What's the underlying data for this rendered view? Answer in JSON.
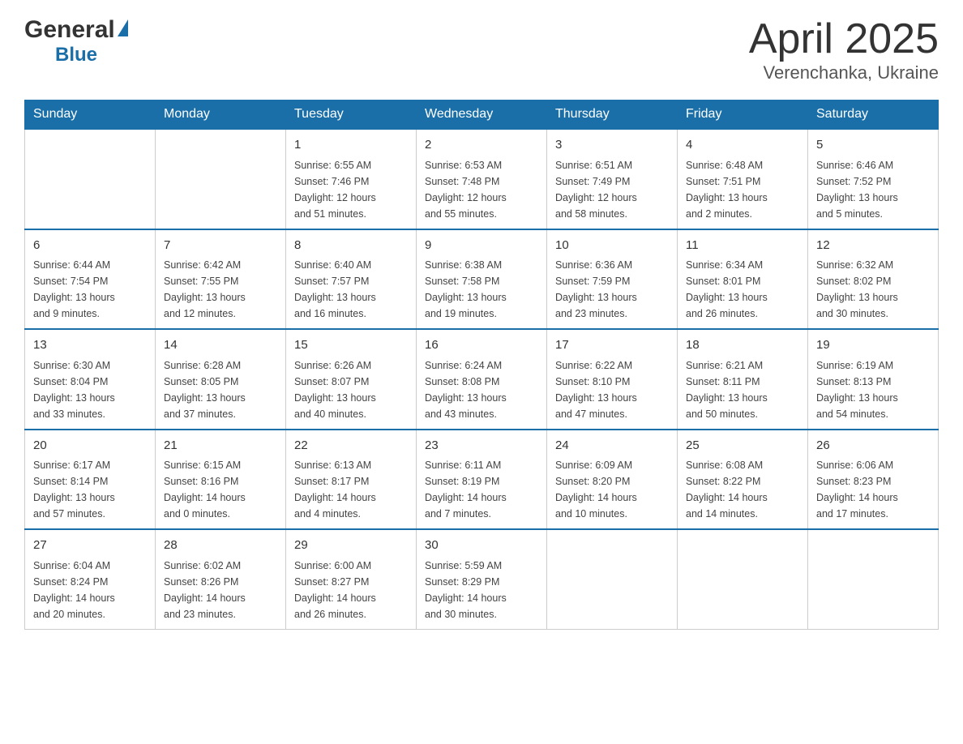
{
  "header": {
    "logo_general": "General",
    "logo_blue": "Blue",
    "month_title": "April 2025",
    "location": "Verenchanka, Ukraine"
  },
  "days_of_week": [
    "Sunday",
    "Monday",
    "Tuesday",
    "Wednesday",
    "Thursday",
    "Friday",
    "Saturday"
  ],
  "weeks": [
    {
      "days": [
        {
          "number": "",
          "info": ""
        },
        {
          "number": "",
          "info": ""
        },
        {
          "number": "1",
          "info": "Sunrise: 6:55 AM\nSunset: 7:46 PM\nDaylight: 12 hours\nand 51 minutes."
        },
        {
          "number": "2",
          "info": "Sunrise: 6:53 AM\nSunset: 7:48 PM\nDaylight: 12 hours\nand 55 minutes."
        },
        {
          "number": "3",
          "info": "Sunrise: 6:51 AM\nSunset: 7:49 PM\nDaylight: 12 hours\nand 58 minutes."
        },
        {
          "number": "4",
          "info": "Sunrise: 6:48 AM\nSunset: 7:51 PM\nDaylight: 13 hours\nand 2 minutes."
        },
        {
          "number": "5",
          "info": "Sunrise: 6:46 AM\nSunset: 7:52 PM\nDaylight: 13 hours\nand 5 minutes."
        }
      ]
    },
    {
      "days": [
        {
          "number": "6",
          "info": "Sunrise: 6:44 AM\nSunset: 7:54 PM\nDaylight: 13 hours\nand 9 minutes."
        },
        {
          "number": "7",
          "info": "Sunrise: 6:42 AM\nSunset: 7:55 PM\nDaylight: 13 hours\nand 12 minutes."
        },
        {
          "number": "8",
          "info": "Sunrise: 6:40 AM\nSunset: 7:57 PM\nDaylight: 13 hours\nand 16 minutes."
        },
        {
          "number": "9",
          "info": "Sunrise: 6:38 AM\nSunset: 7:58 PM\nDaylight: 13 hours\nand 19 minutes."
        },
        {
          "number": "10",
          "info": "Sunrise: 6:36 AM\nSunset: 7:59 PM\nDaylight: 13 hours\nand 23 minutes."
        },
        {
          "number": "11",
          "info": "Sunrise: 6:34 AM\nSunset: 8:01 PM\nDaylight: 13 hours\nand 26 minutes."
        },
        {
          "number": "12",
          "info": "Sunrise: 6:32 AM\nSunset: 8:02 PM\nDaylight: 13 hours\nand 30 minutes."
        }
      ]
    },
    {
      "days": [
        {
          "number": "13",
          "info": "Sunrise: 6:30 AM\nSunset: 8:04 PM\nDaylight: 13 hours\nand 33 minutes."
        },
        {
          "number": "14",
          "info": "Sunrise: 6:28 AM\nSunset: 8:05 PM\nDaylight: 13 hours\nand 37 minutes."
        },
        {
          "number": "15",
          "info": "Sunrise: 6:26 AM\nSunset: 8:07 PM\nDaylight: 13 hours\nand 40 minutes."
        },
        {
          "number": "16",
          "info": "Sunrise: 6:24 AM\nSunset: 8:08 PM\nDaylight: 13 hours\nand 43 minutes."
        },
        {
          "number": "17",
          "info": "Sunrise: 6:22 AM\nSunset: 8:10 PM\nDaylight: 13 hours\nand 47 minutes."
        },
        {
          "number": "18",
          "info": "Sunrise: 6:21 AM\nSunset: 8:11 PM\nDaylight: 13 hours\nand 50 minutes."
        },
        {
          "number": "19",
          "info": "Sunrise: 6:19 AM\nSunset: 8:13 PM\nDaylight: 13 hours\nand 54 minutes."
        }
      ]
    },
    {
      "days": [
        {
          "number": "20",
          "info": "Sunrise: 6:17 AM\nSunset: 8:14 PM\nDaylight: 13 hours\nand 57 minutes."
        },
        {
          "number": "21",
          "info": "Sunrise: 6:15 AM\nSunset: 8:16 PM\nDaylight: 14 hours\nand 0 minutes."
        },
        {
          "number": "22",
          "info": "Sunrise: 6:13 AM\nSunset: 8:17 PM\nDaylight: 14 hours\nand 4 minutes."
        },
        {
          "number": "23",
          "info": "Sunrise: 6:11 AM\nSunset: 8:19 PM\nDaylight: 14 hours\nand 7 minutes."
        },
        {
          "number": "24",
          "info": "Sunrise: 6:09 AM\nSunset: 8:20 PM\nDaylight: 14 hours\nand 10 minutes."
        },
        {
          "number": "25",
          "info": "Sunrise: 6:08 AM\nSunset: 8:22 PM\nDaylight: 14 hours\nand 14 minutes."
        },
        {
          "number": "26",
          "info": "Sunrise: 6:06 AM\nSunset: 8:23 PM\nDaylight: 14 hours\nand 17 minutes."
        }
      ]
    },
    {
      "days": [
        {
          "number": "27",
          "info": "Sunrise: 6:04 AM\nSunset: 8:24 PM\nDaylight: 14 hours\nand 20 minutes."
        },
        {
          "number": "28",
          "info": "Sunrise: 6:02 AM\nSunset: 8:26 PM\nDaylight: 14 hours\nand 23 minutes."
        },
        {
          "number": "29",
          "info": "Sunrise: 6:00 AM\nSunset: 8:27 PM\nDaylight: 14 hours\nand 26 minutes."
        },
        {
          "number": "30",
          "info": "Sunrise: 5:59 AM\nSunset: 8:29 PM\nDaylight: 14 hours\nand 30 minutes."
        },
        {
          "number": "",
          "info": ""
        },
        {
          "number": "",
          "info": ""
        },
        {
          "number": "",
          "info": ""
        }
      ]
    }
  ]
}
